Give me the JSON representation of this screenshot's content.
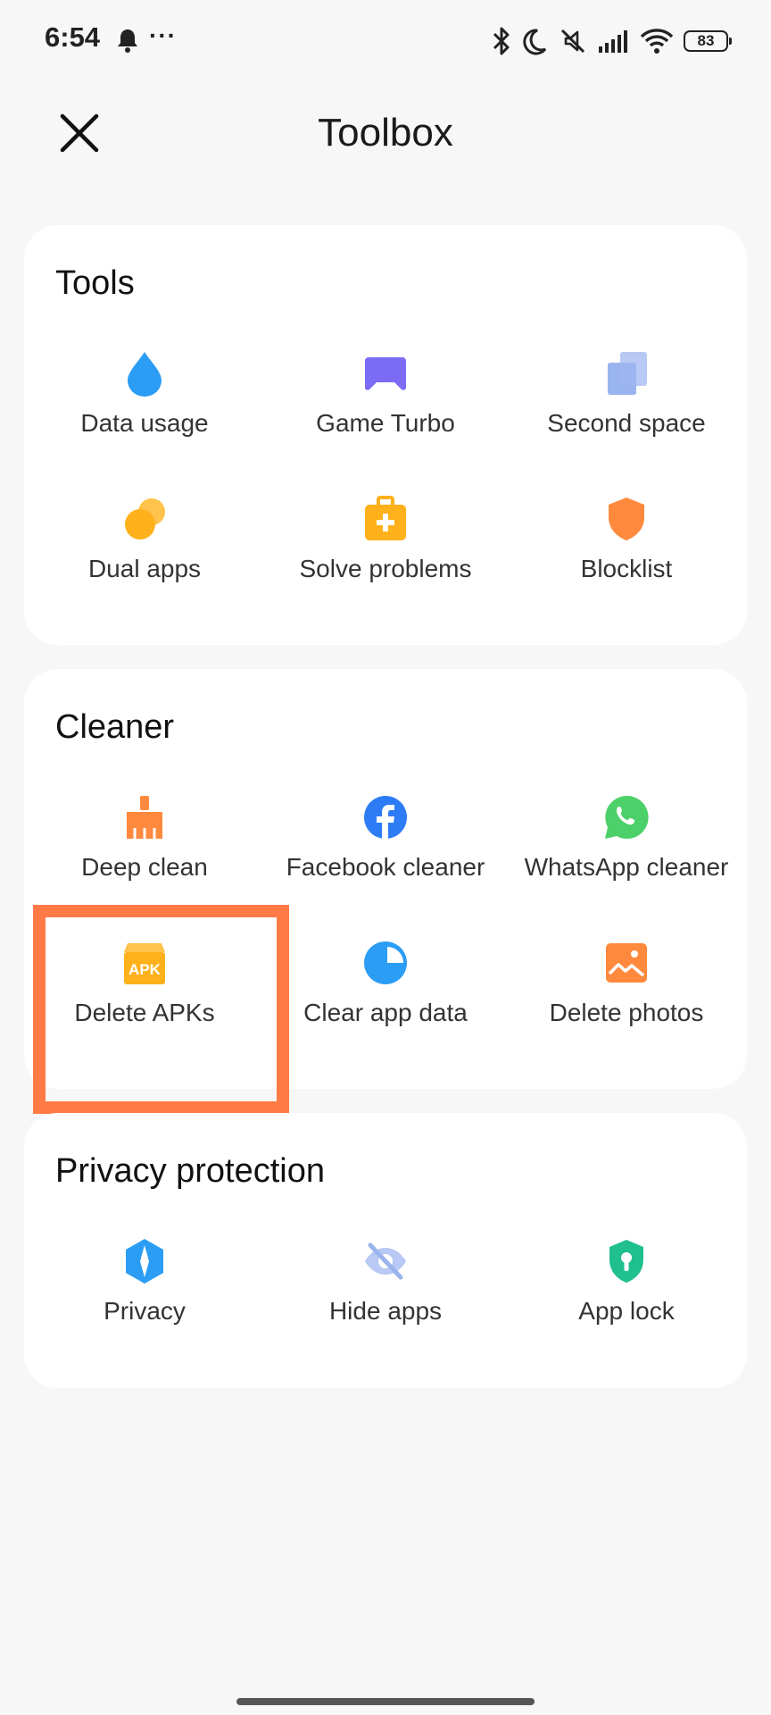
{
  "status_bar": {
    "time": "6:54",
    "notification_icons": [
      "bell-icon",
      "more-dots-icon"
    ],
    "more_glyph": "···",
    "right_icons": [
      "bluetooth-icon",
      "moon-icon",
      "mute-icon",
      "signal-icon",
      "wifi-icon"
    ],
    "battery": "83"
  },
  "header": {
    "close_icon": "close-icon",
    "title": "Toolbox"
  },
  "sections": {
    "tools": {
      "title": "Tools",
      "items": [
        {
          "label": "Data usage",
          "icon": "water-drop-icon",
          "color": "#2b9df4"
        },
        {
          "label": "Game Turbo",
          "icon": "gamepad-icon",
          "color": "#7c6cf5"
        },
        {
          "label": "Second space",
          "icon": "copy-squares-icon",
          "color": "#9ab4ee"
        },
        {
          "label": "Dual apps",
          "icon": "dual-circles-icon",
          "color": "#ffb11b"
        },
        {
          "label": "Solve problems",
          "icon": "first-aid-kit-icon",
          "color": "#ffb11b"
        },
        {
          "label": "Blocklist",
          "icon": "shield-icon",
          "color": "#ff8a3d"
        }
      ]
    },
    "cleaner": {
      "title": "Cleaner",
      "items": [
        {
          "label": "Deep clean",
          "icon": "broom-icon",
          "color": "#ff8a3d"
        },
        {
          "label": "Facebook cleaner",
          "icon": "facebook-icon",
          "color": "#2d7cf6"
        },
        {
          "label": "WhatsApp cleaner",
          "icon": "whatsapp-icon",
          "color": "#4cd06a"
        },
        {
          "label": "Delete APKs",
          "icon": "apk-box-icon",
          "color": "#ffb11b",
          "icon_text": "APK"
        },
        {
          "label": "Clear app data",
          "icon": "pie-chart-icon",
          "color": "#2b9df4"
        },
        {
          "label": "Delete photos",
          "icon": "photo-icon",
          "color": "#ff8a3d"
        }
      ]
    },
    "privacy": {
      "title": "Privacy protection",
      "items": [
        {
          "label": "Privacy",
          "icon": "privacy-shield-icon",
          "color": "#2b9df4"
        },
        {
          "label": "Hide apps",
          "icon": "eye-off-icon",
          "color": "#9ab4ee"
        },
        {
          "label": "App lock",
          "icon": "lock-shield-icon",
          "color": "#1fbf8e"
        }
      ]
    }
  },
  "highlight_color": "#ff7a45"
}
